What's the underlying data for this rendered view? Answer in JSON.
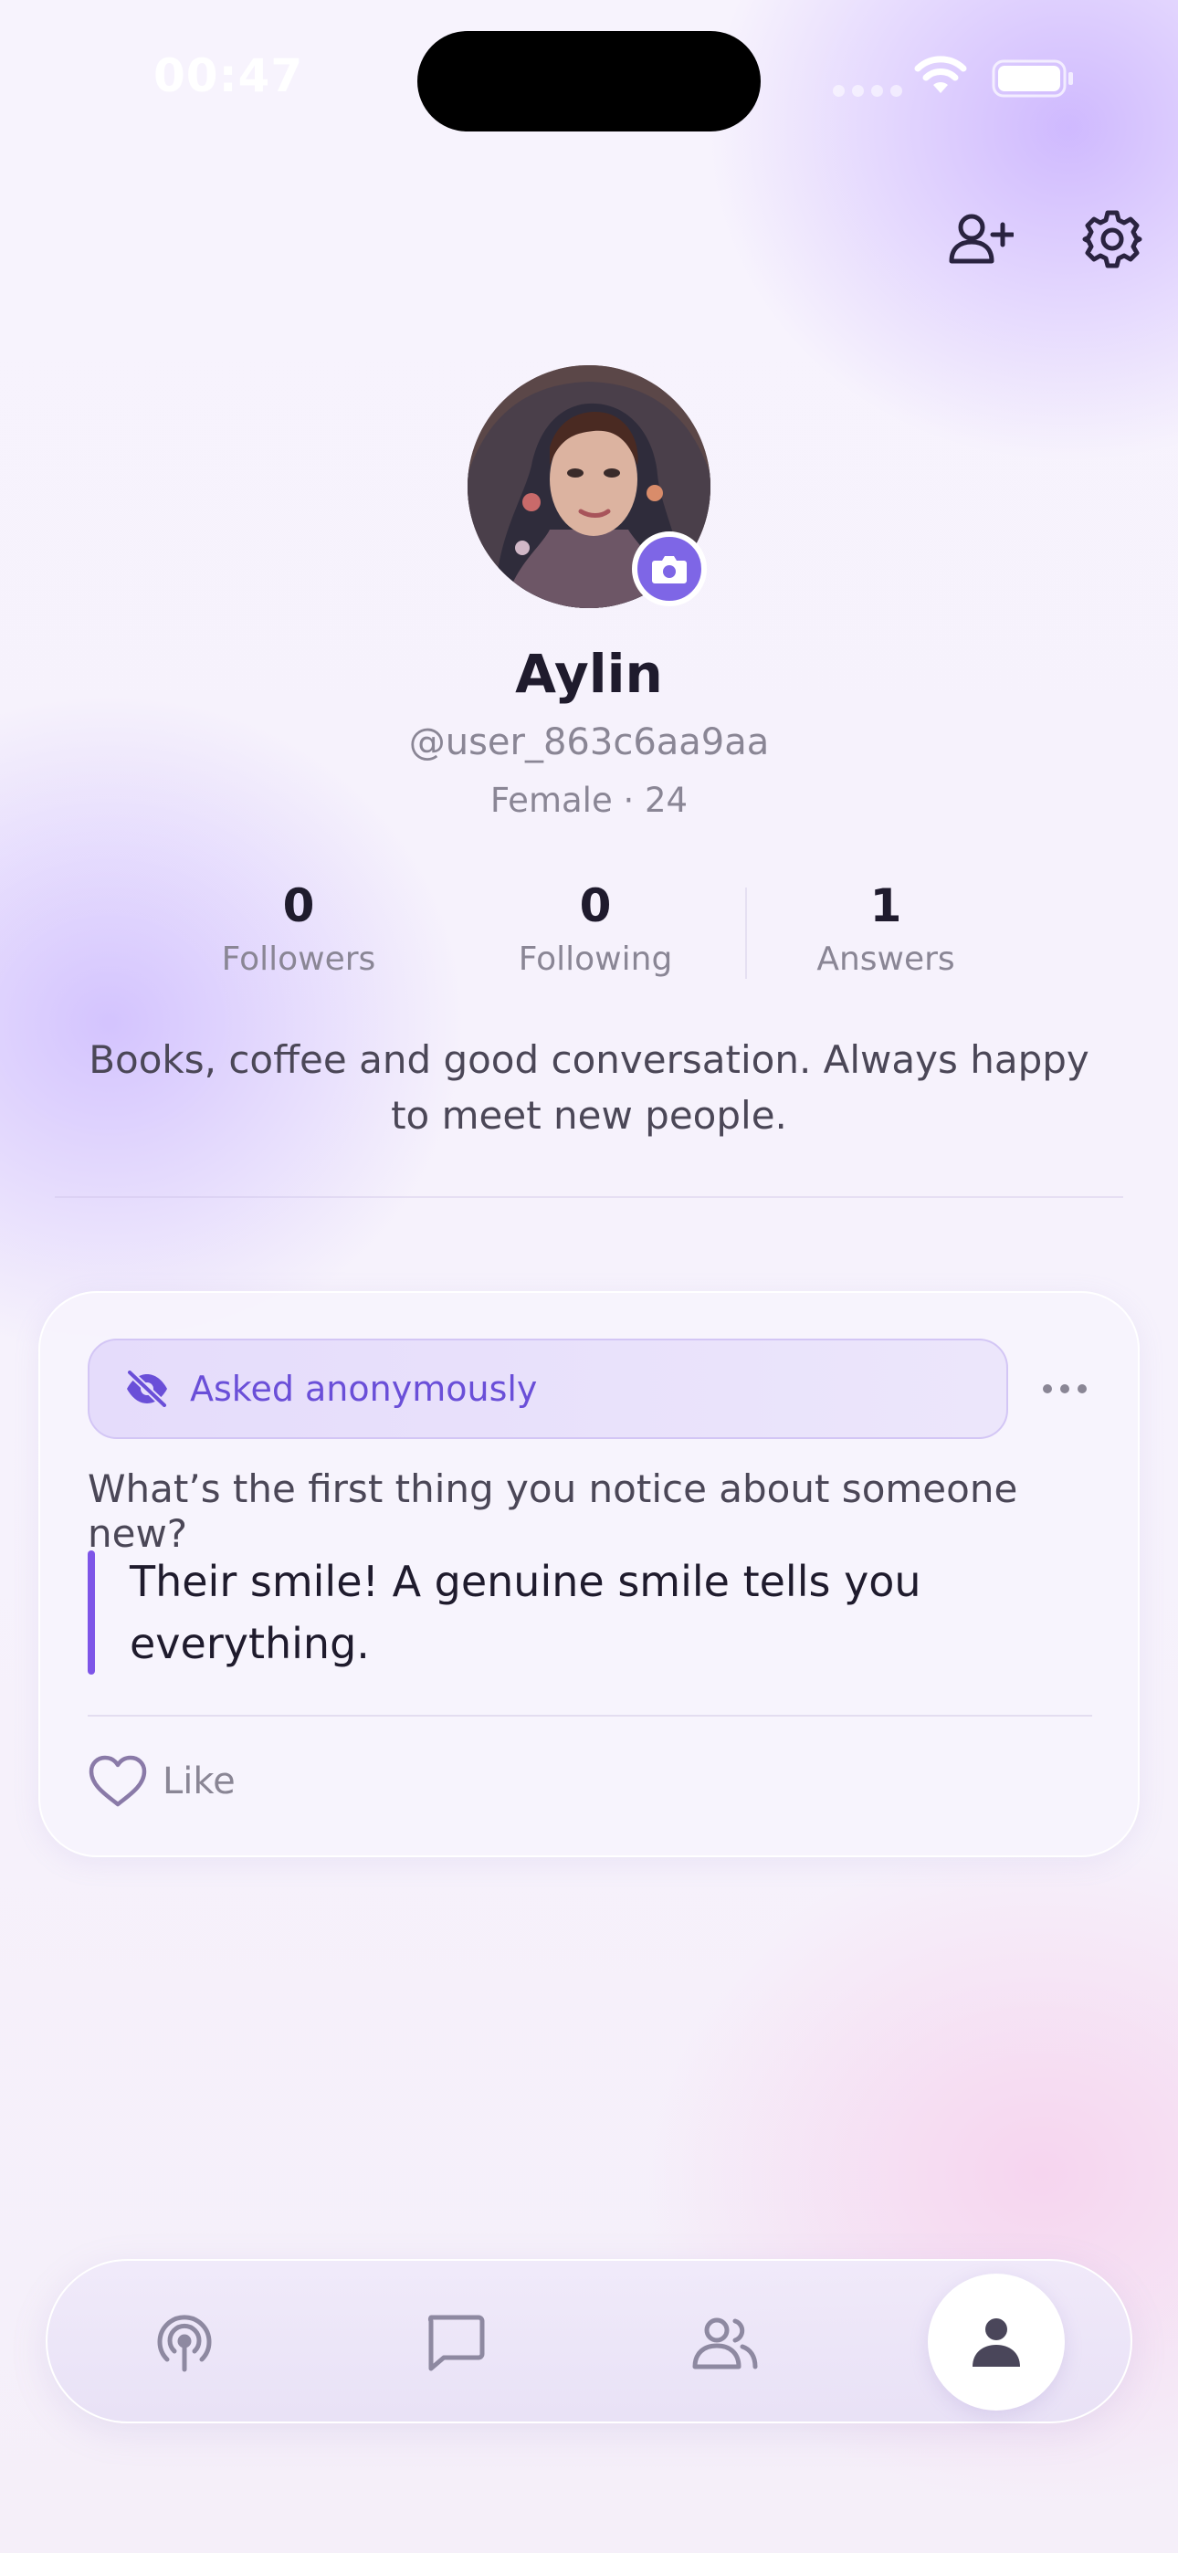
{
  "status_bar": {
    "time": "00:47"
  },
  "top_actions": {
    "add_friend_icon": "person-add-icon",
    "settings_icon": "gear-icon"
  },
  "profile": {
    "name": "Aylin",
    "handle": "@user_863c6aa9aa",
    "meta": "Female · 24",
    "bio": "Books, coffee and good conversation. Always happy to meet new people.",
    "avatar_badge_icon": "camera-icon"
  },
  "stats": [
    {
      "value": "0",
      "label": "Followers"
    },
    {
      "value": "0",
      "label": "Following"
    },
    {
      "value": "1",
      "label": "Answers"
    }
  ],
  "card": {
    "anon_label": "Asked anonymously",
    "question": "What’s the first thing you notice about someone new?",
    "answer": "Their smile! A genuine smile tells you everything.",
    "like_label": "Like"
  },
  "nav": {
    "items": [
      "broadcast-icon",
      "chat-icon",
      "people-icon",
      "profile-icon"
    ],
    "active": "profile-icon"
  },
  "colors": {
    "accent": "#7e66e6",
    "accent_text": "#6a4fd8",
    "text_primary": "#1f1b2d",
    "text_muted": "#8a8695"
  }
}
